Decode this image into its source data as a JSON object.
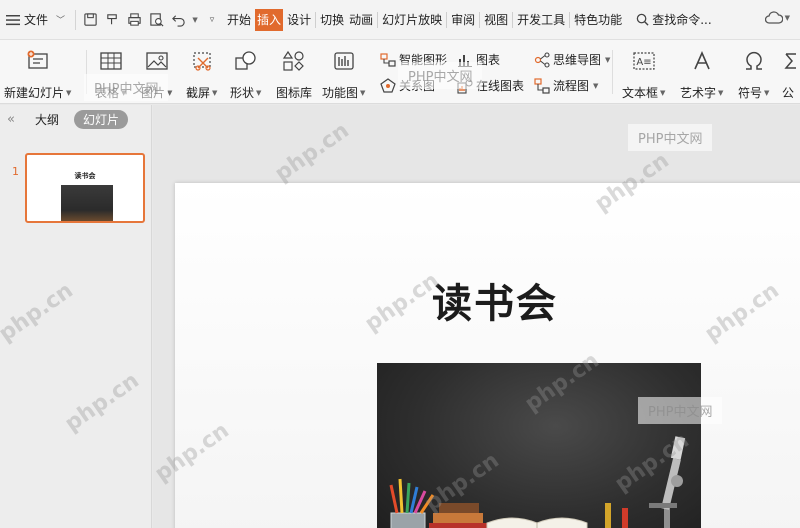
{
  "menubar": {
    "file_label": "文件",
    "tabs": [
      "开始",
      "插入",
      "设计",
      "切换",
      "动画",
      "幻灯片放映",
      "审阅",
      "视图",
      "开发工具",
      "特色功能"
    ],
    "active_tab": "插入",
    "search_label": "查找命令..."
  },
  "ribbon": {
    "new_slide": "新建幻灯片",
    "table": "表格",
    "picture": "图片",
    "screenshot": "截屏",
    "shape": "形状",
    "icon_library": "图标库",
    "function_chart": "功能图",
    "smart_graphic": "智能图形",
    "chart": "图表",
    "relation_chart": "关系图",
    "online_chart": "在线图表",
    "mind_map": "思维导图",
    "flowchart": "流程图",
    "text_box": "文本框",
    "word_art": "艺术字",
    "symbol": "符号",
    "formula_partial": "公"
  },
  "left_panel": {
    "outline_tab": "大纲",
    "slides_tab": "幻灯片",
    "slide_number": "1",
    "thumb_title": "读书会"
  },
  "slide": {
    "title": "读书会"
  },
  "watermarks": {
    "box_text": "PHP中文网",
    "diag_text": "php.cn"
  },
  "colors": {
    "accent": "#e16a2d",
    "thumb_border": "#e6763a"
  }
}
